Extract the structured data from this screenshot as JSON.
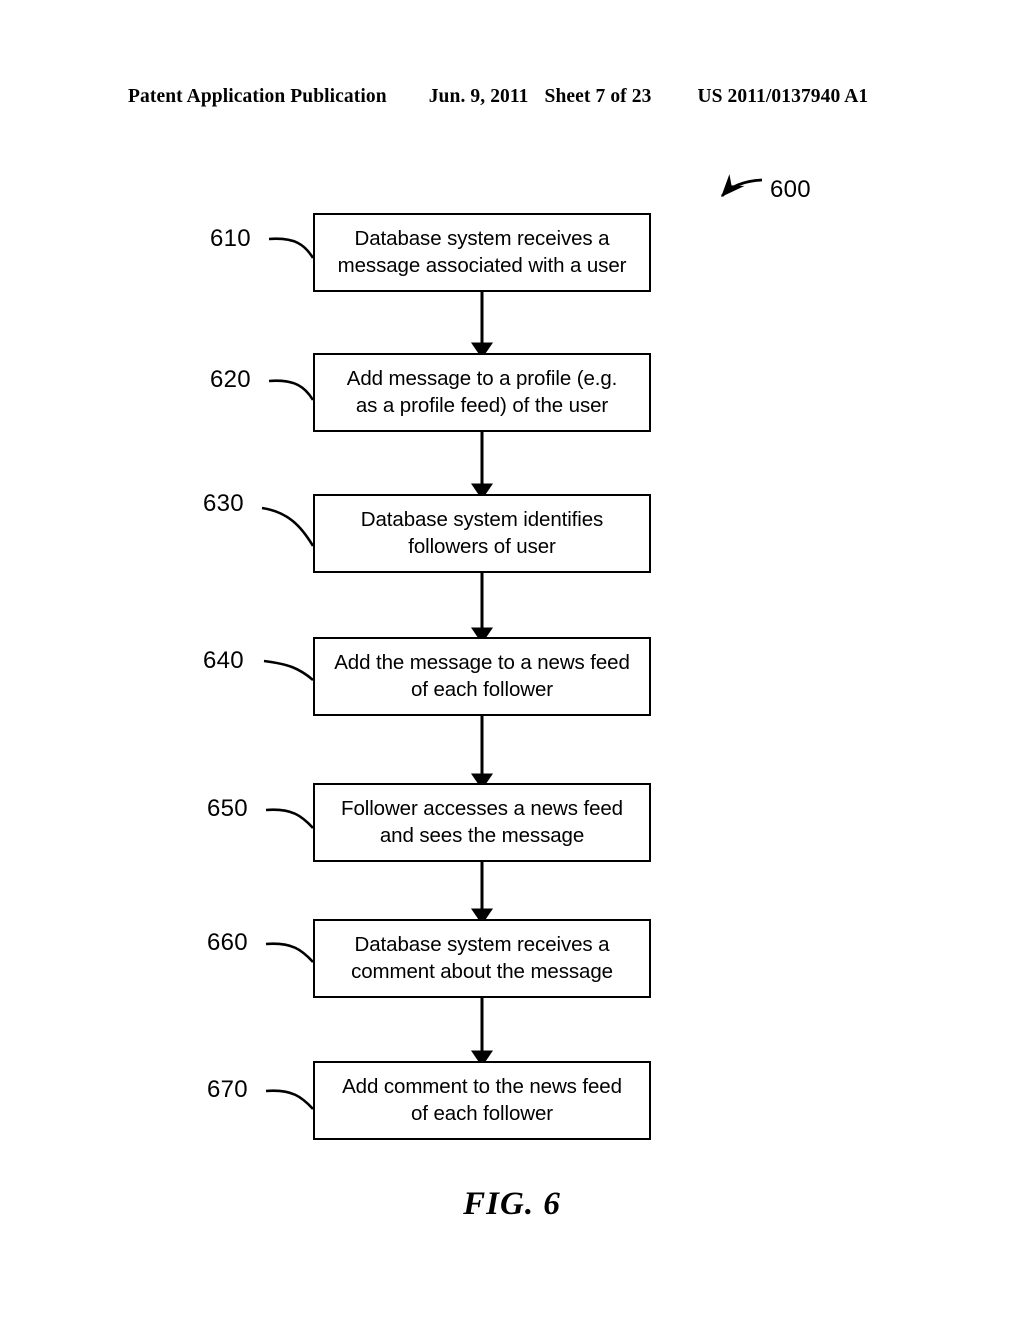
{
  "header": {
    "publication": "Patent Application Publication",
    "date": "Jun. 9, 2011",
    "sheet": "Sheet 7 of 23",
    "patent_number": "US 2011/0137940 A1"
  },
  "figure": {
    "caption": "FIG. 6",
    "diagram_reference": "600",
    "type": "flowchart",
    "orientation": "vertical",
    "colors": {
      "background": "#ffffff",
      "stroke": "#000000",
      "text": "#000000"
    }
  },
  "flowchart": {
    "steps": [
      {
        "ref": "610",
        "line1": "Database system receives a",
        "line2": "message associated with a user",
        "text": "Database system receives a message associated with a user"
      },
      {
        "ref": "620",
        "line1": "Add message to a profile (e.g.",
        "line2": "as a profile feed) of the user",
        "text": "Add message to a profile (e.g. as a profile feed) of the user"
      },
      {
        "ref": "630",
        "line1": "Database system identifies",
        "line2": "followers of user",
        "text": "Database system identifies followers of user"
      },
      {
        "ref": "640",
        "line1": "Add the message to a news feed",
        "line2": "of each follower",
        "text": "Add the message to a news feed of each follower"
      },
      {
        "ref": "650",
        "line1": "Follower accesses a news feed",
        "line2": "and sees the message",
        "text": "Follower accesses a news feed and sees the message"
      },
      {
        "ref": "660",
        "line1": "Database system receives a",
        "line2": "comment about the message",
        "text": "Database system receives a comment about the message"
      },
      {
        "ref": "670",
        "line1": "Add comment to the news feed",
        "line2": "of each follower",
        "text": "Add comment to the news feed of each follower"
      }
    ],
    "connectors": [
      {
        "from": "610",
        "to": "620",
        "style": "arrow-down"
      },
      {
        "from": "620",
        "to": "630",
        "style": "arrow-down"
      },
      {
        "from": "630",
        "to": "640",
        "style": "arrow-down"
      },
      {
        "from": "640",
        "to": "650",
        "style": "arrow-down"
      },
      {
        "from": "650",
        "to": "660",
        "style": "arrow-down"
      },
      {
        "from": "660",
        "to": "670",
        "style": "arrow-down"
      }
    ]
  }
}
